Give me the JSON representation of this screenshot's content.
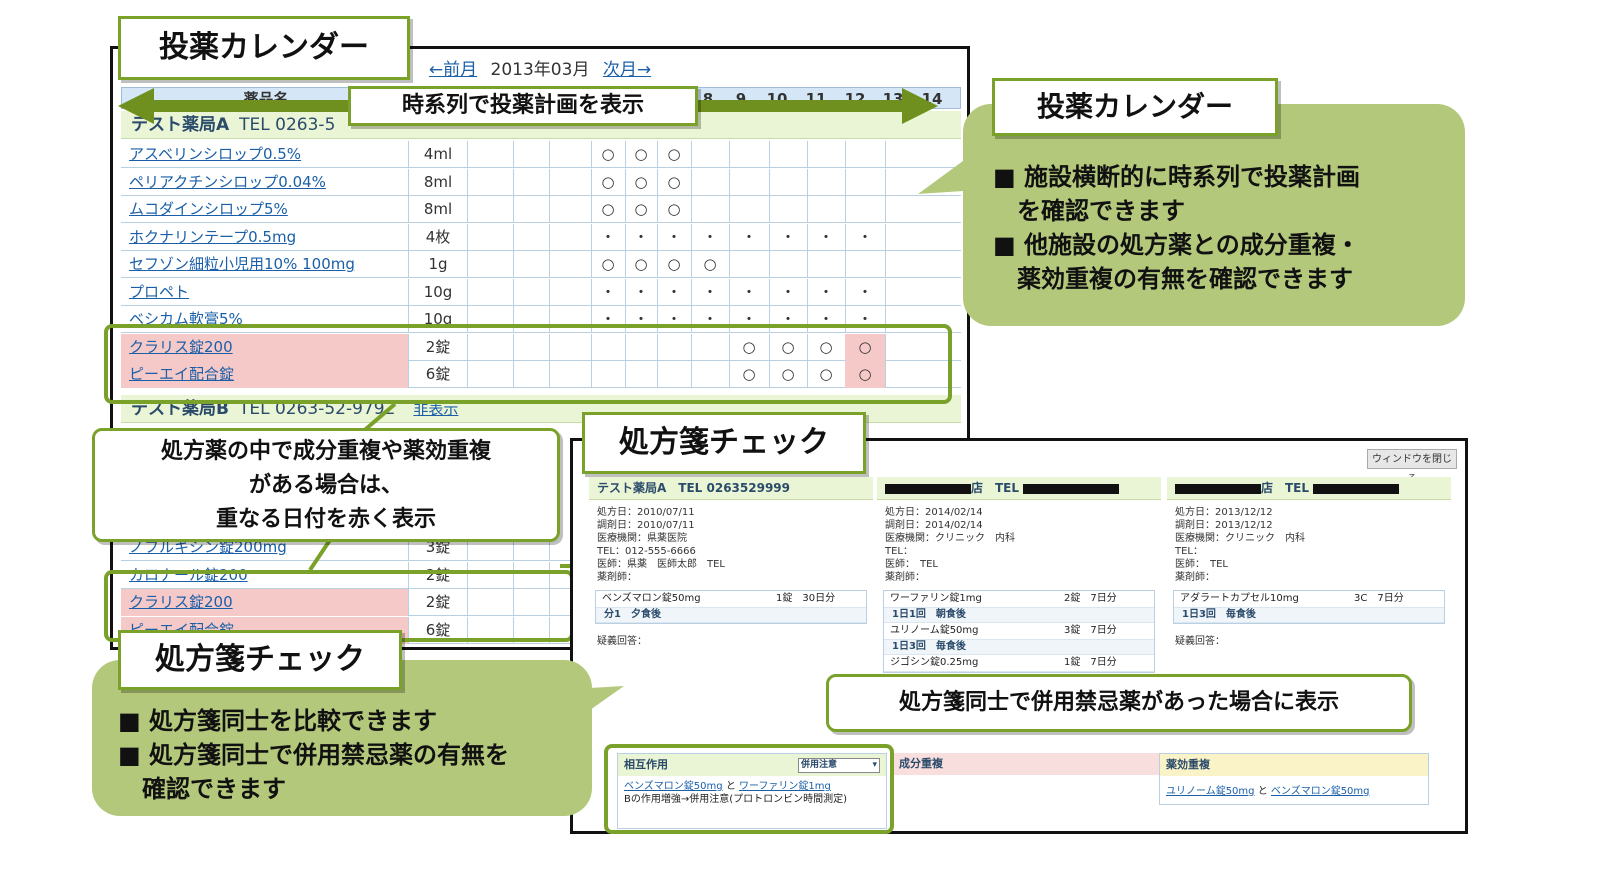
{
  "calendar": {
    "title": "投薬カレンダー",
    "nav": {
      "prev": "←前月",
      "month": "2013年03月",
      "next": "次月→"
    },
    "header": {
      "drug_name": "薬品名",
      "days": [
        "8",
        "9",
        "10",
        "11",
        "12",
        "13",
        "14"
      ]
    },
    "timeline_label": "時系列で投薬計画を表示",
    "pharmacy_a": {
      "name": "テスト薬局A",
      "tel": "TEL 0263-5"
    },
    "pharmacy_b": {
      "name": "テスト薬局B",
      "tel": "TEL 0263-52-9792",
      "hide": "非表示"
    },
    "drugs_a": [
      {
        "name": "アスベリンシロップ0.5%",
        "amount": "4ml",
        "marks": [
          "○",
          "○",
          "○",
          "",
          "",
          "",
          "",
          ""
        ]
      },
      {
        "name": "ペリアクチンシロップ0.04%",
        "amount": "8ml",
        "marks": [
          "○",
          "○",
          "○",
          "",
          "",
          "",
          "",
          ""
        ]
      },
      {
        "name": "ムコダインシロップ5%",
        "amount": "8ml",
        "marks": [
          "○",
          "○",
          "○",
          "",
          "",
          "",
          "",
          ""
        ]
      },
      {
        "name": "ホクナリンテープ0.5mg",
        "amount": "4枚",
        "marks": [
          "・",
          "・",
          "・",
          "・",
          "・",
          "・",
          "・",
          "・"
        ]
      },
      {
        "name": "セフゾン細粒小児用10% 100mg",
        "amount": "1g",
        "marks": [
          "○",
          "○",
          "○",
          "○",
          "",
          "",
          "",
          ""
        ]
      },
      {
        "name": "プロペト",
        "amount": "10g",
        "marks": [
          "・",
          "・",
          "・",
          "・",
          "・",
          "・",
          "・",
          "・"
        ]
      },
      {
        "name": "ベシカム軟膏5%",
        "amount": "10g",
        "marks": [
          "・",
          "・",
          "・",
          "・",
          "・",
          "・",
          "・",
          "・"
        ]
      },
      {
        "name": "クラリス錠200",
        "amount": "2錠",
        "marks": [
          "",
          "",
          "",
          "",
          "○",
          "○",
          "○",
          "○"
        ]
      },
      {
        "name": "ピーエイ配合錠",
        "amount": "6錠",
        "marks": [
          "",
          "",
          "",
          "",
          "○",
          "○",
          "○",
          "○"
        ]
      }
    ],
    "drugs_b": [
      {
        "name": "ノフルキシン錠200mg",
        "amount": "3錠"
      },
      {
        "name": "カロナール錠200",
        "amount": "2錠"
      },
      {
        "name": "クラリス錠200",
        "amount": "2錠"
      },
      {
        "name": "ピーエイ配合錠",
        "amount": "6錠"
      }
    ]
  },
  "callouts": {
    "calendar_title": "投薬カレンダー",
    "calendar_points": [
      "■ 施設横断的に時系列で投薬計画",
      "　を確認できます",
      "■ 他施設の処方薬との成分重複・",
      "　薬効重複の有無を確認できます"
    ],
    "red_note": [
      "処方薬の中で成分重複や薬効重複",
      "がある場合は、",
      "重なる日付を赤く表示"
    ],
    "rx_title": "処方箋チェック",
    "rx_points": [
      "■ 処方箋同士を比較できます",
      "■ 処方箋同士で併用禁忌薬の有無を",
      "　確認できます"
    ],
    "contra_note": "処方箋同士で併用禁忌薬があった場合に表示"
  },
  "rx": {
    "close": "ウィンドウを閉じる",
    "cols": [
      {
        "header": "テスト薬局A　TEL 0263529999",
        "meta": [
          "処方日：2010/07/11",
          "調剤日：2010/07/11",
          "医療機関：県薬医院",
          "TEL：012-555-6666",
          "医師：県薬　医師太郎　TEL",
          "薬剤師："
        ],
        "drugs": [
          {
            "name": "ベンズマロン錠50mg",
            "qty": "1錠　30日分",
            "dose": "分1　夕食後"
          }
        ],
        "q": "疑義回答："
      },
      {
        "header": "店　TEL",
        "meta": [
          "処方日：2014/02/14",
          "調剤日：2014/02/14",
          "医療機関：クリニック　内科",
          "TEL：",
          "医師：　TEL",
          "薬剤師："
        ],
        "drugs": [
          {
            "name": "ワーファリン錠1mg",
            "qty": "2錠　7日分",
            "dose": "1日1回　朝食後"
          },
          {
            "name": "ユリノーム錠50mg",
            "qty": "3錠　7日分",
            "dose": "1日3回　毎食後"
          },
          {
            "name": "ジゴシン錠0.25mg",
            "qty": "1錠　7日分",
            "dose": ""
          }
        ],
        "q": ""
      },
      {
        "header": "店　TEL",
        "meta": [
          "処方日：2013/12/12",
          "調剤日：2013/12/12",
          "医療機関：クリニック　内科",
          "TEL：",
          "医師：　TEL",
          "薬剤師："
        ],
        "drugs": [
          {
            "name": "アダラートカプセル10mg",
            "qty": "3C　7日分",
            "dose": "1日3回　毎食後"
          }
        ],
        "q": "疑義回答："
      }
    ],
    "interaction": {
      "title": "相互作用",
      "select": "併用注意",
      "drug1": "ベンズマロン錠50mg",
      "and": "と",
      "drug2": "ワーファリン錠1mg",
      "detail": "Bの作用増強→併用注意(プロトロンビン時間測定)"
    },
    "component": {
      "title": "成分重複"
    },
    "efficacy": {
      "title": "薬効重複",
      "drug1": "ユリノーム錠50mg",
      "and": "と",
      "drug2": "ベンズマロン錠50mg"
    }
  }
}
